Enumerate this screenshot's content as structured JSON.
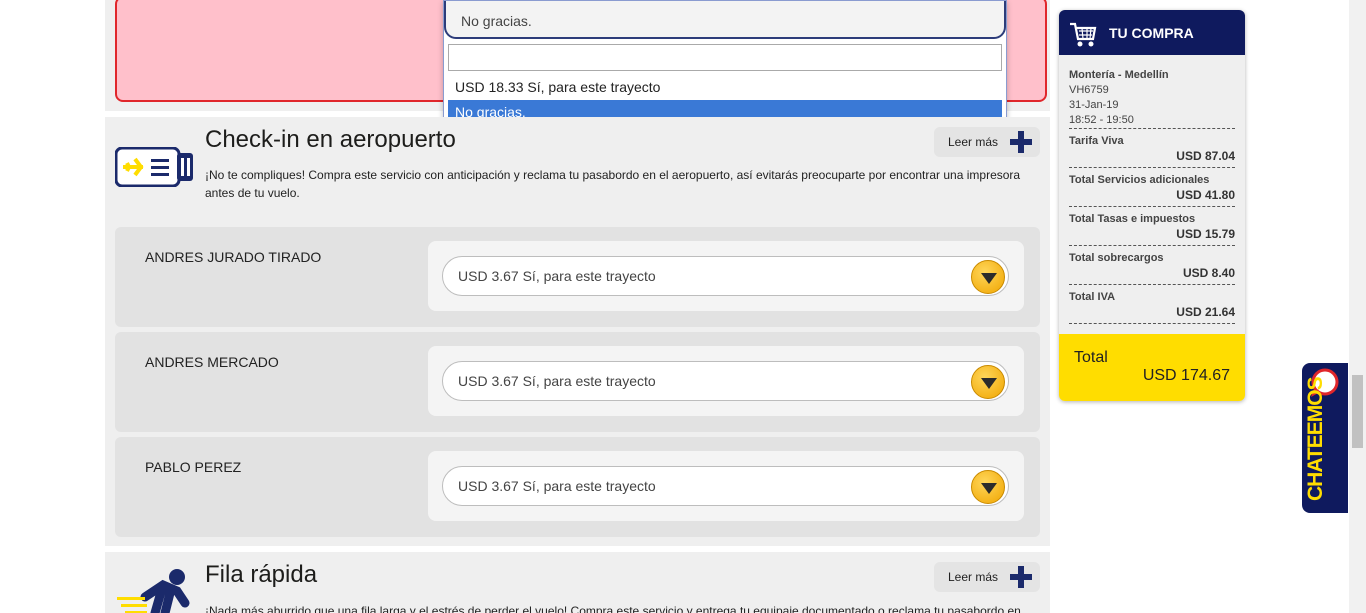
{
  "top_section": {
    "dropdown": {
      "current_value": "No gracias.",
      "search_value": "",
      "options": [
        "USD 18.33 Sí, para este trayecto",
        "No gracias."
      ],
      "highlighted_index": 1
    }
  },
  "checkin": {
    "title": "Check-in en aeropuerto",
    "description": "¡No te compliques! Compra este servicio con anticipación y reclama tu pasabordo en el aeropuerto, así evitarás preocuparte por encontrar una impresora antes de tu vuelo.",
    "leer_mas": "Leer más",
    "passengers": [
      {
        "name": "ANDRES JURADO TIRADO",
        "selection": "USD 3.67 Sí, para este trayecto"
      },
      {
        "name": "ANDRES MERCADO",
        "selection": "USD 3.67 Sí, para este trayecto"
      },
      {
        "name": "PABLO PEREZ",
        "selection": "USD 3.67 Sí, para este trayecto"
      }
    ]
  },
  "fila": {
    "title": "Fila rápida",
    "description": "¡Nada más aburrido que una fila larga y el estrés de perder el vuelo! Compra este servicio y entrega tu equipaje documentado o reclama tu pasabordo en",
    "leer_mas": "Leer más"
  },
  "sidebar": {
    "title": "TU COMPRA",
    "route": "Montería - Medellín",
    "flight_number": "VH6759",
    "date": "31-Jan-19",
    "time": "18:52 - 19:50",
    "items": [
      {
        "label": "Tarifa Viva",
        "value": "USD 87.04"
      },
      {
        "label": "Total Servicios adicionales",
        "value": "USD 41.80"
      },
      {
        "label": "Total Tasas e impuestos",
        "value": "USD 15.79"
      },
      {
        "label": "Total sobrecargos",
        "value": "USD 8.40"
      },
      {
        "label": "Total IVA",
        "value": "USD 21.64"
      }
    ],
    "total_label": "Total",
    "total_value": "USD 174.67"
  },
  "chat": {
    "label": "CHATEEMOS"
  },
  "colors": {
    "brand_navy": "#0f1a5e",
    "brand_yellow": "#ffdd00",
    "alert_red": "#e0262b",
    "highlight_blue": "#3a79d6"
  }
}
